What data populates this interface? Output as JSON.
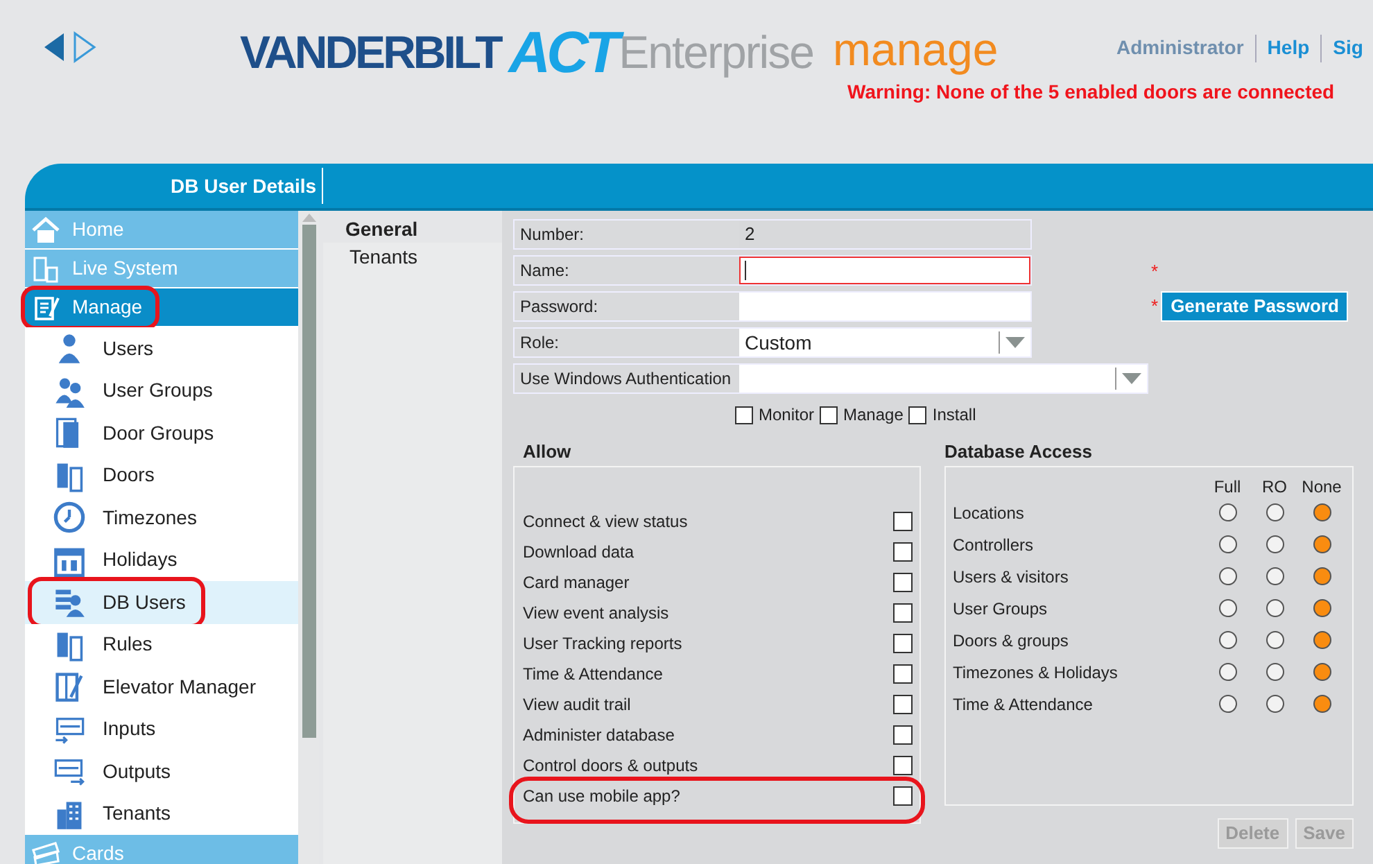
{
  "nav_arrows": {
    "back_disabled": false
  },
  "logo": {
    "brand": "VANDERBILT",
    "product": "ACT",
    "edition": "Enterprise",
    "module": "manage"
  },
  "top_links": [
    "Administrator",
    "Help",
    "Sig"
  ],
  "warning": "Warning: None of the 5 enabled doors are connected",
  "header_bar": {
    "title": "DB User Details"
  },
  "sidebar": {
    "items": [
      {
        "label": "Home",
        "selected": false,
        "circled": false
      },
      {
        "label": "Live System",
        "selected": false,
        "circled": false
      },
      {
        "label": "Manage",
        "selected": true,
        "circled": true,
        "children": [
          {
            "label": "Users",
            "selected": false,
            "circled": false
          },
          {
            "label": "User Groups",
            "selected": false,
            "circled": false
          },
          {
            "label": "Door Groups",
            "selected": false,
            "circled": false
          },
          {
            "label": "Doors",
            "selected": false,
            "circled": false
          },
          {
            "label": "Timezones",
            "selected": false,
            "circled": false
          },
          {
            "label": "Holidays",
            "selected": false,
            "circled": false
          },
          {
            "label": "DB Users",
            "selected": true,
            "circled": true
          },
          {
            "label": "Rules",
            "selected": false,
            "circled": false
          },
          {
            "label": "Elevator Manager",
            "selected": false,
            "circled": false
          },
          {
            "label": "Inputs",
            "selected": false,
            "circled": false
          },
          {
            "label": "Outputs",
            "selected": false,
            "circled": false
          },
          {
            "label": "Tenants",
            "selected": false,
            "circled": false
          }
        ]
      },
      {
        "label": "Cards",
        "selected": false,
        "circled": false
      }
    ]
  },
  "subnav": [
    {
      "label": "General",
      "selected": true
    },
    {
      "label": "Tenants",
      "selected": false
    }
  ],
  "form": {
    "number": {
      "label": "Number:",
      "value": "2"
    },
    "name": {
      "label": "Name:",
      "invalid": true,
      "focused": true,
      "required": "*"
    },
    "password": {
      "label": "Password:",
      "required": "*"
    },
    "generate_button": "Generate Password",
    "role": {
      "label": "Role:",
      "value": "Custom"
    },
    "windows_auth": {
      "label": "Use Windows Authentication"
    },
    "role_checks": [
      {
        "label": "Monitor",
        "checked": false
      },
      {
        "label": "Manage",
        "checked": false
      },
      {
        "label": "Install",
        "checked": false
      }
    ]
  },
  "allow": {
    "title": "Allow",
    "items": [
      {
        "label": "Connect & view status",
        "checked": false,
        "circled": false
      },
      {
        "label": "Download data",
        "checked": false,
        "circled": false
      },
      {
        "label": "Card manager",
        "checked": false,
        "circled": false
      },
      {
        "label": "View event analysis",
        "checked": false,
        "circled": false
      },
      {
        "label": "User Tracking reports",
        "checked": false,
        "circled": false
      },
      {
        "label": "Time & Attendance",
        "checked": false,
        "circled": false
      },
      {
        "label": "View audit trail",
        "checked": false,
        "circled": false
      },
      {
        "label": "Administer database",
        "checked": false,
        "circled": false
      },
      {
        "label": "Control doors & outputs",
        "checked": false,
        "circled": false
      },
      {
        "label": "Can use mobile app?",
        "checked": false,
        "circled": true
      }
    ]
  },
  "database_access": {
    "title": "Database Access",
    "columns": [
      "Full",
      "RO",
      "None"
    ],
    "rows": [
      {
        "label": "Locations",
        "choices": [
          {
            "selected": false
          },
          {
            "selected": false
          },
          {
            "selected": true
          }
        ]
      },
      {
        "label": "Controllers",
        "choices": [
          {
            "selected": false
          },
          {
            "selected": false
          },
          {
            "selected": true
          }
        ]
      },
      {
        "label": "Users & visitors",
        "choices": [
          {
            "selected": false
          },
          {
            "selected": false
          },
          {
            "selected": true
          }
        ]
      },
      {
        "label": "User Groups",
        "choices": [
          {
            "selected": false
          },
          {
            "selected": false
          },
          {
            "selected": true
          }
        ]
      },
      {
        "label": "Doors & groups",
        "choices": [
          {
            "selected": false
          },
          {
            "selected": false
          },
          {
            "selected": true
          }
        ]
      },
      {
        "label": "Timezones & Holidays",
        "choices": [
          {
            "selected": false
          },
          {
            "selected": false
          },
          {
            "selected": true
          }
        ]
      },
      {
        "label": "Time & Attendance",
        "choices": [
          {
            "selected": false
          },
          {
            "selected": false
          },
          {
            "selected": true
          }
        ]
      }
    ]
  },
  "actions": [
    {
      "label": "Delete",
      "disabled": true
    },
    {
      "label": "Save",
      "disabled": true
    }
  ]
}
